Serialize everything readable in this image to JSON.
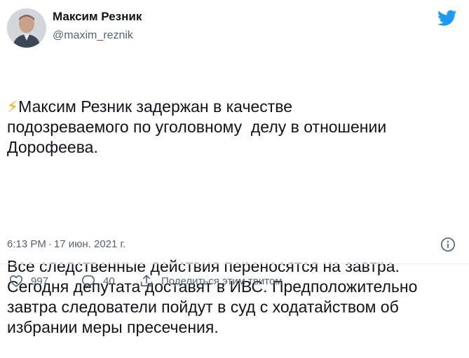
{
  "author": {
    "name": "Максим Резник",
    "handle": "@maxim_reznik"
  },
  "tweet": {
    "bolt": "⚡",
    "paragraph_1": "Максим Резник задержан в качестве\nподозреваемого по уголовному  делу в отношении\nДорофеева.",
    "paragraph_2": "Все следственные действия переносятся на завтра.\nСегодня депутата доставят в ИВС. Предположительно\nзавтра следователи пойдут в суд с ходатайством об\nизбрании меры пресечения."
  },
  "meta": {
    "time": "6:13 PM",
    "separator": "·",
    "date": "17 июн. 2021 г."
  },
  "actions": {
    "likes": "997",
    "replies": "40",
    "share_label": "Поделиться этим твитом"
  },
  "icons": {
    "logo": "twitter-bird-icon",
    "info": "info-icon",
    "like": "heart-icon",
    "reply": "reply-bubble-icon",
    "share": "share-icon"
  },
  "colors": {
    "brand": "#1d9bf0",
    "text": "#0f1419",
    "muted": "#536471"
  }
}
